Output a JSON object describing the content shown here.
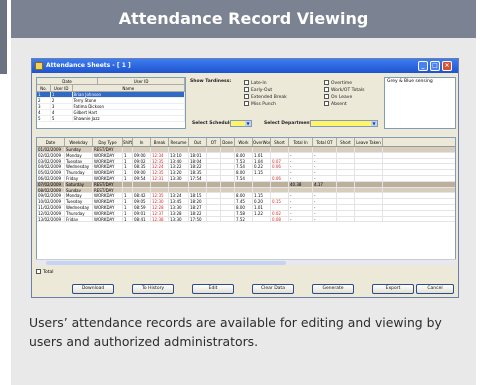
{
  "banner_title": "Attendance Record Viewing",
  "caption": "Users’ attendance records are available for editing and viewing by users and authorized administrators.",
  "colors": {
    "banner": "#7b8292",
    "titlebar": "#1e54cf",
    "highlight": "#fff46a",
    "weekend": "#d7cdbd"
  },
  "window": {
    "title": "Attendance Sheets - [ 1 ]",
    "employee_table": {
      "headers": [
        "No.",
        "User ID",
        "Name"
      ],
      "group_headers": [
        "Date",
        "User ID"
      ],
      "rows": [
        {
          "no": "1",
          "id": "1",
          "name": "Brian Johnson",
          "selected": true
        },
        {
          "no": "2",
          "id": "2",
          "name": "Terry Stone",
          "selected": false
        },
        {
          "no": "3",
          "id": "3",
          "name": "Fatima Dickson",
          "selected": false
        },
        {
          "no": "4",
          "id": "4",
          "name": "Gilbert Hart",
          "selected": false
        },
        {
          "no": "5",
          "id": "5",
          "name": "Shawnie Jazz",
          "selected": false
        }
      ]
    },
    "show_tardiness_label": "Show Tardiness:",
    "checks_left": [
      "Late-In",
      "Early-Out",
      "Extended Break",
      "Miss Punch"
    ],
    "checks_right": [
      "Overtime",
      "Work/OT Totals",
      "On Leave",
      "Absent"
    ],
    "select_schedule_label": "Select Schedule :",
    "select_department_label": "Select Department :",
    "right_panel_text": "Grey & Blue sensing",
    "grid": {
      "headers": [
        "Date",
        "Weekday",
        "Day Type",
        "Shift",
        "In",
        "Break",
        "Resume",
        "Out",
        "OT",
        "Done",
        "Work",
        "OverWork",
        "Short",
        "Total In",
        "Total OT",
        "Short",
        "Leave Taken"
      ],
      "rows": [
        {
          "c": [
            "01/02/2009",
            "Sunday",
            "REST/DAY",
            "",
            "",
            "",
            "",
            "",
            "",
            "",
            "",
            "",
            "",
            "",
            "",
            "",
            ""
          ],
          "t": "wk"
        },
        {
          "c": [
            "02/02/2009",
            "Monday",
            "WORKDAY",
            "1",
            "09:00",
            "12:34",
            "13:10",
            "18:01",
            "",
            "",
            "8.00",
            "1.01",
            "",
            "-",
            "-",
            "",
            ""
          ],
          "t": ""
        },
        {
          "c": [
            "03/02/2009",
            "Tuesday",
            "WORKDAY",
            "1",
            "09:02",
            "12:35",
            "13:40",
            "18:04",
            "",
            "",
            "7.53",
            "1.04",
            "0.07",
            "-",
            "-",
            "",
            ""
          ],
          "t": ""
        },
        {
          "c": [
            "04/02/2009",
            "Wednesday",
            "WORKDAY",
            "1",
            "08:35",
            "12:24",
            "13:22",
            "18:22",
            "",
            "",
            "7.54",
            "0.22",
            "0.06",
            "-",
            "-",
            "",
            ""
          ],
          "t": ""
        },
        {
          "c": [
            "05/02/2009",
            "Thursday",
            "WORKDAY",
            "1",
            "09:00",
            "12:35",
            "13:20",
            "18:35",
            "",
            "",
            "8.00",
            "1.15",
            "",
            "-",
            "-",
            "",
            ""
          ],
          "t": ""
        },
        {
          "c": [
            "06/02/2009",
            "Friday",
            "WORKDAY",
            "1",
            "09:54",
            "12:31",
            "13:30",
            "17:54",
            "",
            "",
            "7.54",
            "",
            "0.06",
            "-",
            "-",
            "",
            ""
          ],
          "t": ""
        },
        {
          "c": [
            "07/02/2009",
            "Saturday",
            "REST/DAY",
            "",
            "",
            "",
            "",
            "",
            "",
            "",
            "",
            "",
            "",
            "40.38",
            "4.17",
            "",
            ""
          ],
          "t": "wk2"
        },
        {
          "c": [
            "08/02/2009",
            "Sunday",
            "REST/DAY",
            "",
            "",
            "",
            "",
            "",
            "",
            "",
            "",
            "",
            "",
            "",
            "",
            "",
            ""
          ],
          "t": "wk"
        },
        {
          "c": [
            "09/02/2009",
            "Monday",
            "WORKDAY",
            "1",
            "08:42",
            "12:35",
            "13:24",
            "18:15",
            "",
            "",
            "8.00",
            "1.15",
            "",
            "-",
            "-",
            "",
            ""
          ],
          "t": ""
        },
        {
          "c": [
            "10/02/2009",
            "Tuesday",
            "WORKDAY",
            "1",
            "09:05",
            "12:30",
            "13:45",
            "18:20",
            "",
            "",
            "7.45",
            "0.20",
            "0.15",
            "-",
            "-",
            "",
            ""
          ],
          "t": ""
        },
        {
          "c": [
            "11/02/2009",
            "Wednesday",
            "WORKDAY",
            "1",
            "08:59",
            "12:28",
            "13:30",
            "18:27",
            "",
            "",
            "8.00",
            "1.01",
            "",
            "-",
            "-",
            "",
            ""
          ],
          "t": ""
        },
        {
          "c": [
            "12/02/2009",
            "Thursday",
            "WORKDAY",
            "1",
            "09:01",
            "12:37",
            "13:28",
            "18:22",
            "",
            "",
            "7.58",
            "1.22",
            "0.02",
            "-",
            "-",
            "",
            ""
          ],
          "t": ""
        },
        {
          "c": [
            "13/02/2009",
            "Friday",
            "WORKDAY",
            "1",
            "08:41",
            "12:38",
            "13:30",
            "17:50",
            "",
            "",
            "7.52",
            "",
            "0.08",
            "-",
            "-",
            "",
            ""
          ],
          "t": ""
        }
      ]
    },
    "total_label": "Total",
    "buttons": [
      "Download",
      "To History",
      "Edit",
      "Clear Data",
      "Generate",
      "Export",
      "Cancel"
    ]
  }
}
